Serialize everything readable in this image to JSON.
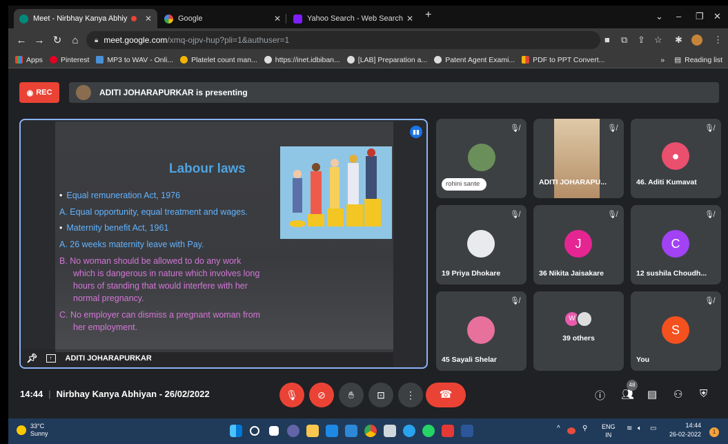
{
  "browser": {
    "tabs": [
      {
        "label": "Meet - Nirbhay Kanya Abhiy",
        "close": "✕"
      },
      {
        "label": "Google",
        "close": "✕"
      },
      {
        "label": "Yahoo Search - Web Search",
        "close": "✕"
      }
    ],
    "new_tab": "+",
    "url_host": "meet.google.com",
    "url_path": "/xmq-ojpv-hup?pli=1&authuser=1",
    "bookmarks": [
      "Apps",
      "Pinterest",
      "MP3 to WAV - Onli...",
      "Platelet count man...",
      "https://inet.idbiban...",
      "[LAB] Preparation a...",
      "Patent Agent Exami...",
      "PDF to PPT Convert..."
    ],
    "bookmarks_more": "»",
    "reading_list": "Reading list"
  },
  "meet": {
    "rec_label": "REC",
    "presenting": "ADITI JOHARAPURKAR is presenting",
    "presenter_name": "ADITI JOHARAPURKAR",
    "slide": {
      "title": "Labour laws",
      "lines": [
        {
          "bullet": "•",
          "text": "Equal remuneration Act, 1976"
        },
        {
          "bullet": "",
          "text": "A. Equal opportunity, equal treatment and wages."
        },
        {
          "bullet": "•",
          "text": "Maternity benefit Act, 1961"
        },
        {
          "bullet": "",
          "text": "A. 26 weeks maternity leave with Pay."
        },
        {
          "bullet": "",
          "text": "B. No woman should be allowed to do any work"
        },
        {
          "bullet": "",
          "text": "which is dangerous in nature which involves long"
        },
        {
          "bullet": "",
          "text": "hours of standing that would interfere with her"
        },
        {
          "bullet": "",
          "text": "normal pregnancy."
        },
        {
          "bullet": "",
          "text": "C. No employer can dismiss a pregnant woman from"
        },
        {
          "bullet": "",
          "text": "her employment."
        }
      ]
    },
    "participants": [
      {
        "name": "rohini sante",
        "initial": "",
        "color": "#6b8f5a"
      },
      {
        "name": "ADITI JOHARAPU...",
        "initial": "",
        "color": "#c9a27e"
      },
      {
        "name": "46. Aditi Kumavat",
        "initial": "",
        "color": "#ea4f6d"
      },
      {
        "name": "19 Priya Dhokare",
        "initial": "",
        "color": "#e8eaed"
      },
      {
        "name": "36 Nikita Jaisakare",
        "initial": "J",
        "color": "#e52592"
      },
      {
        "name": "12 sushila Choudh...",
        "initial": "C",
        "color": "#a142f4"
      },
      {
        "name": "45 Sayali Shelar",
        "initial": "",
        "color": "#e8719b"
      },
      {
        "name": "39 others",
        "initial": "W",
        "color": "#e85aad"
      },
      {
        "name": "You",
        "initial": "S",
        "color": "#f4511e"
      }
    ],
    "time": "14:44",
    "meeting_title": "Nirbhay Kanya Abhiyan - 26/02/2022",
    "people_count": "48"
  },
  "taskbar": {
    "temp": "33°C",
    "weather": "Sunny",
    "lang1": "ENG",
    "lang2": "IN",
    "time": "14:44",
    "date": "26-02-2022",
    "notif_count": "1"
  },
  "colors": {
    "accent": "#8ab4f8",
    "red": "#ea4335",
    "meet_bg": "#202124"
  }
}
